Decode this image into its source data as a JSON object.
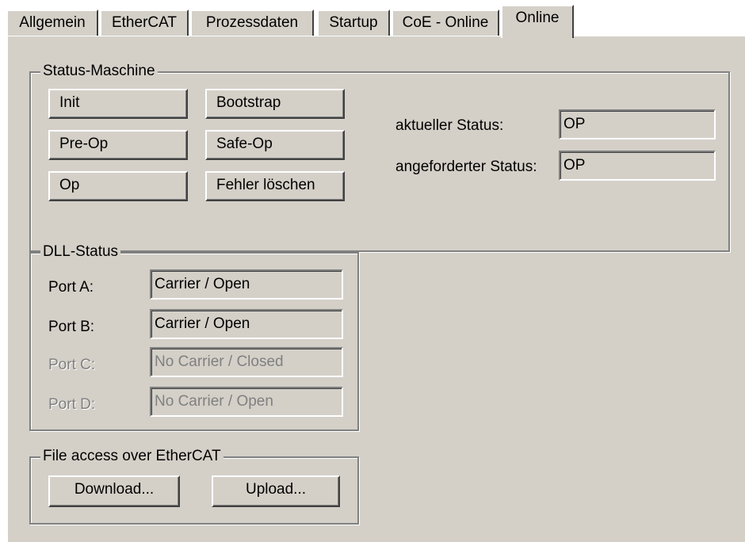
{
  "tabs": [
    {
      "label": "Allgemein",
      "active": false
    },
    {
      "label": "EtherCAT",
      "active": false
    },
    {
      "label": "Prozessdaten",
      "active": false
    },
    {
      "label": "Startup",
      "active": false
    },
    {
      "label": "CoE - Online",
      "active": false
    },
    {
      "label": "Online",
      "active": true
    }
  ],
  "status_machine": {
    "title": "Status-Maschine",
    "buttons": {
      "init": "Init",
      "bootstrap": "Bootstrap",
      "pre_op": "Pre-Op",
      "safe_op": "Safe-Op",
      "op": "Op",
      "clear_errors": "Fehler löschen"
    },
    "current_status_label": "aktueller Status:",
    "current_status_value": "OP",
    "requested_status_label": "angeforderter Status:",
    "requested_status_value": "OP"
  },
  "dll_status": {
    "title": "DLL-Status",
    "ports": [
      {
        "label": "Port A:",
        "value": "Carrier / Open",
        "enabled": true
      },
      {
        "label": "Port B:",
        "value": "Carrier / Open",
        "enabled": true
      },
      {
        "label": "Port C:",
        "value": "No Carrier / Closed",
        "enabled": false
      },
      {
        "label": "Port D:",
        "value": "No Carrier / Open",
        "enabled": false
      }
    ]
  },
  "file_access": {
    "title": "File access over EtherCAT",
    "download_label": "Download...",
    "upload_label": "Upload..."
  },
  "colors": {
    "face": "#d4d0c8",
    "disabled_text": "#808080"
  }
}
